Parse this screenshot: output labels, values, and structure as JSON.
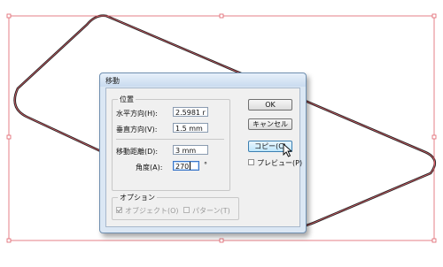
{
  "dialog": {
    "title": "移動",
    "position_group": {
      "legend": "位置",
      "horizontal_label": "水平方向(H):",
      "horizontal_value": "2.5981 r",
      "vertical_label": "垂直方向(V):",
      "vertical_value": "1.5 mm",
      "distance_label": "移動距離(D):",
      "distance_value": "3 mm",
      "angle_label": "角度(A):",
      "angle_value": "270",
      "angle_unit": "°"
    },
    "options_group": {
      "legend": "オプション",
      "objects_label": "オブジェクト(O)",
      "objects_checked": true,
      "objects_disabled": true,
      "pattern_label": "パターン(T)",
      "pattern_checked": false,
      "pattern_disabled": true
    },
    "buttons": {
      "ok": "OK",
      "cancel": "キャンセル",
      "copy": "コピー(C)"
    },
    "preview": {
      "label": "プレビュー(P)",
      "checked": false
    }
  },
  "colors": {
    "selection": "#e0606a",
    "shape_stroke": "#222222",
    "dialog_frame": "#dbe7f4"
  }
}
